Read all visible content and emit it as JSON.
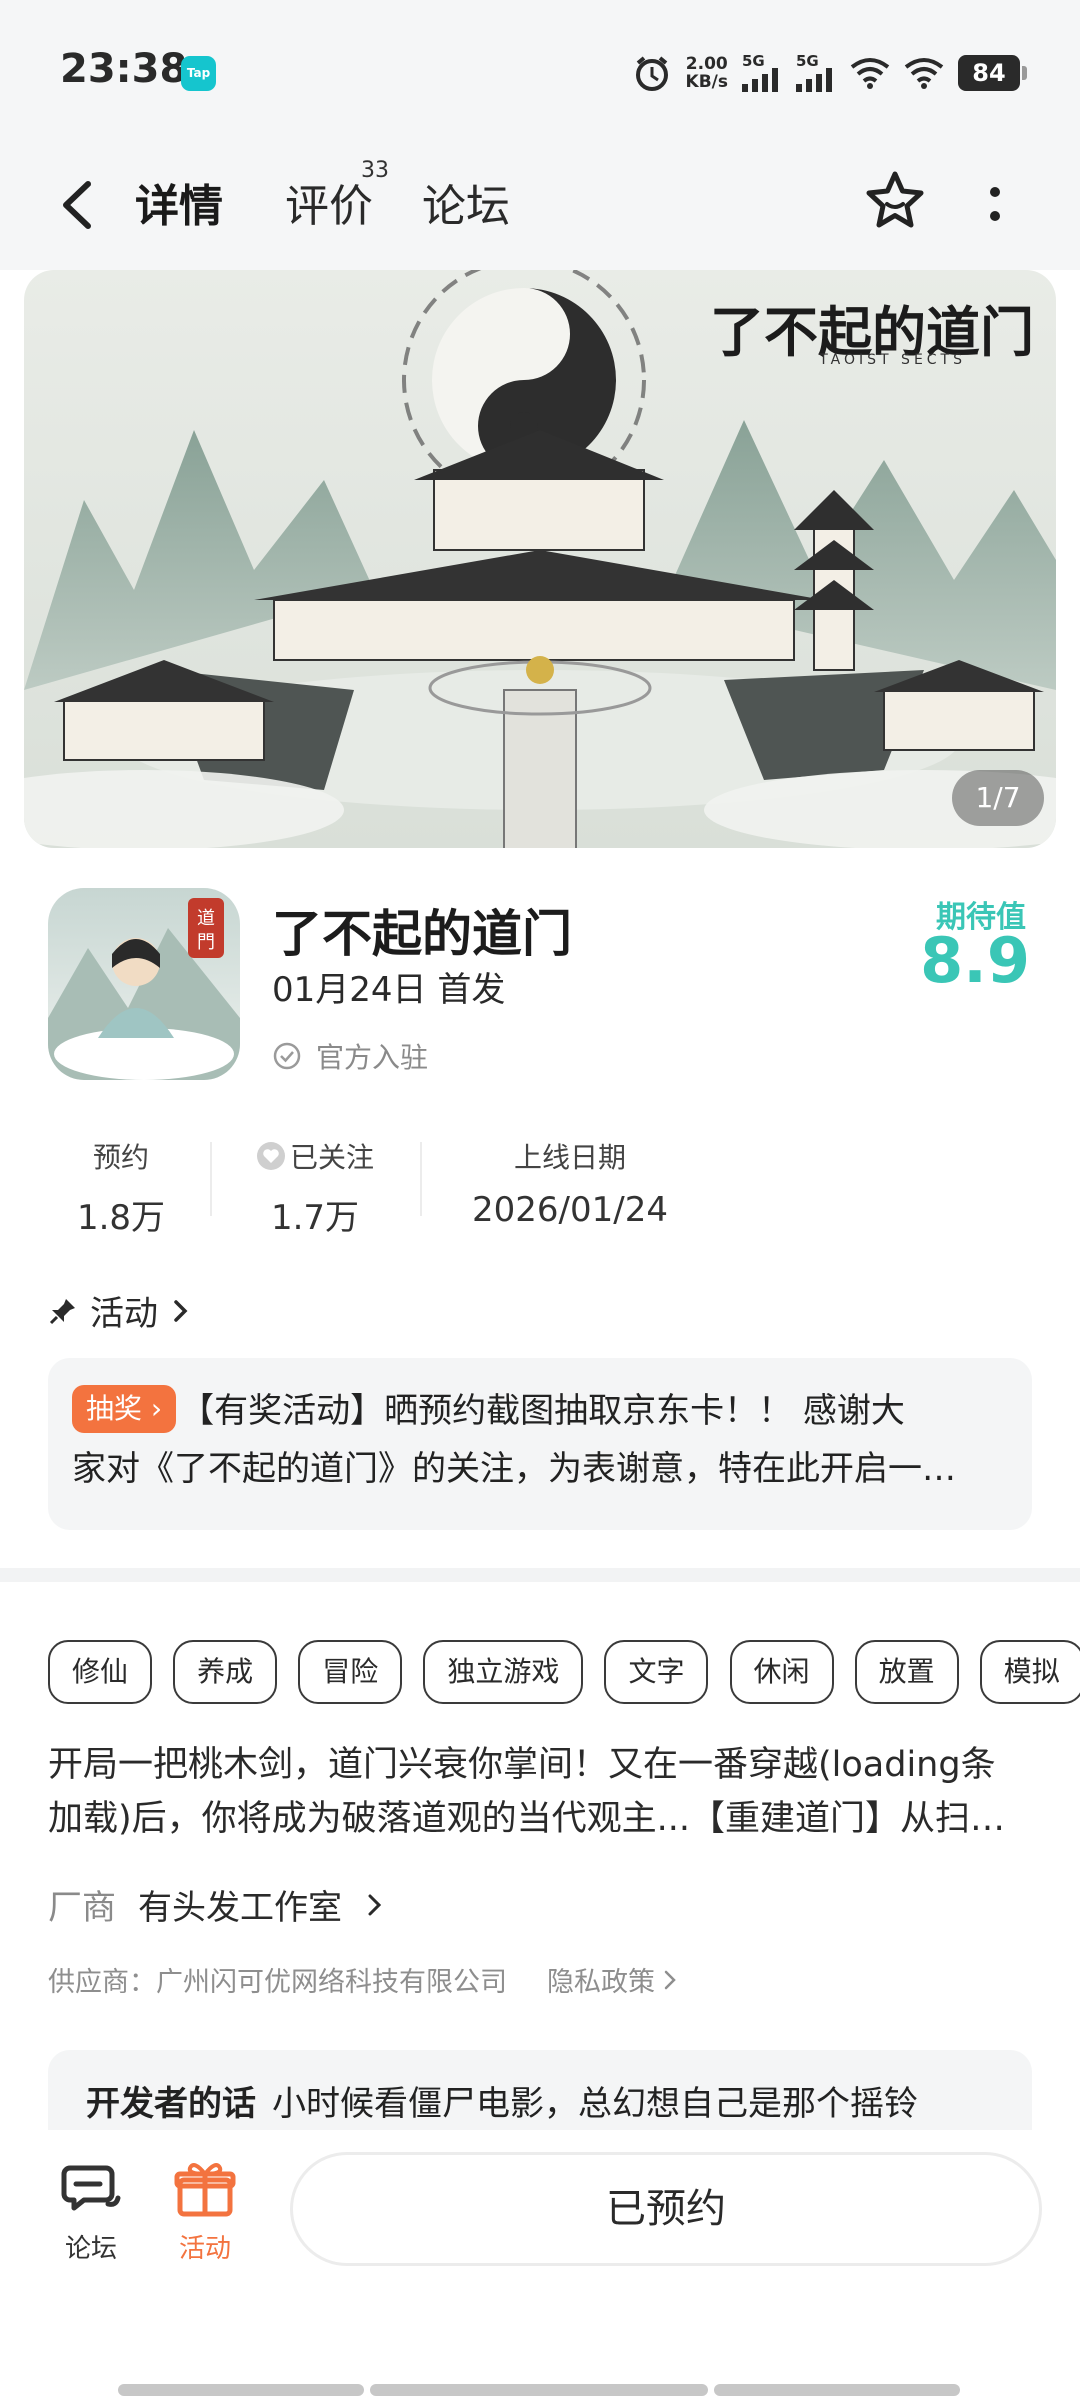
{
  "status": {
    "time": "23:38",
    "tap_badge": "Tap",
    "net_speed_value": "2.00",
    "net_speed_unit": "KB/s",
    "sig1": "5G",
    "sig2": "5G",
    "battery": "84"
  },
  "nav": {
    "tabs": [
      {
        "label": "详情"
      },
      {
        "label": "评价",
        "badge": "33"
      },
      {
        "label": "论坛"
      }
    ]
  },
  "banner": {
    "logo": "了不起的道门",
    "logo_sub": "TAOIST SECTS",
    "counter": "1/7"
  },
  "game": {
    "icon_seal": "道門",
    "title": "了不起的道门",
    "release": "01月24日 首发",
    "official": "官方入驻",
    "expect_label": "期待值",
    "expect_score": "8.9"
  },
  "stats": [
    {
      "label": "预约",
      "value": "1.8万"
    },
    {
      "label": "已关注",
      "value": "1.7万"
    },
    {
      "label": "上线日期",
      "value": "2026/01/24"
    }
  ],
  "activity": {
    "heading": "活动",
    "badge": "抽奖",
    "line1": "【有奖活动】晒预约截图抽取京东卡！！ 感谢大",
    "line2": "家对《了不起的道门》的关注，为表谢意，特在此开启一…"
  },
  "tags": [
    "修仙",
    "养成",
    "冒险",
    "独立游戏",
    "文字",
    "休闲",
    "放置",
    "模拟"
  ],
  "description": {
    "line1": "开局一把桃木剑，道门兴衰你掌间！又在一番穿越(loading条",
    "line2": "加载)后，你将成为破落道观的当代观主...【重建道门】从扫…"
  },
  "vendor": {
    "label": "厂商",
    "name": "有头发工作室"
  },
  "supplier": {
    "text": "供应商：广州闪可优网络科技有限公司",
    "privacy": "隐私政策"
  },
  "developer": {
    "label": "开发者的话",
    "text": "小时候看僵尸电影，总幻想自己是那个摇铃"
  },
  "bottom": {
    "forum": "论坛",
    "activity": "活动",
    "reserved": "已预约"
  },
  "colors": {
    "accent": "#36d3c4",
    "score": "#3ac6b6",
    "orange": "#f3733f"
  }
}
